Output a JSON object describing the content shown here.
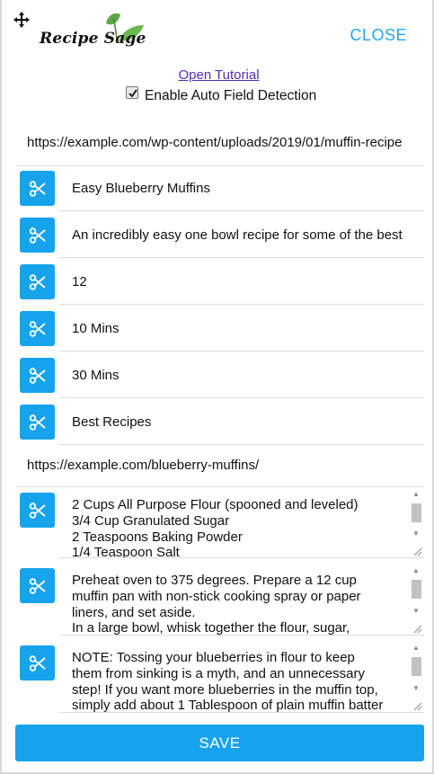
{
  "header": {
    "logo_text": "Recipe Sage",
    "close_label": "CLOSE"
  },
  "tutorial_link": "Open Tutorial",
  "auto_detect": {
    "label": "Enable Auto Field Detection",
    "checked": true
  },
  "source_url": "https://example.com/wp-content/uploads/2019/01/muffin-recipe",
  "fields": [
    {
      "value": "Easy Blueberry Muffins"
    },
    {
      "value": "An incredibly easy one bowl recipe for some of the best"
    },
    {
      "value": "12"
    },
    {
      "value": "10 Mins"
    },
    {
      "value": "30 Mins"
    },
    {
      "value": "Best Recipes"
    }
  ],
  "recipe_url": "https://example.com/blueberry-muffins/",
  "ingredients": [
    "2 Cups All Purpose Flour (spooned and leveled)",
    "3/4 Cup Granulated Sugar",
    "2 Teaspoons Baking Powder",
    "1/4 Teaspoon Salt"
  ],
  "instructions": [
    "Preheat oven to 375 degrees.  Prepare a 12 cup",
    "muffin pan with non-stick cooking spray or paper",
    "liners, and set aside.",
    "In a large bowl, whisk together the flour, sugar,"
  ],
  "notes": [
    "NOTE:  Tossing your blueberries in flour to keep",
    "them from sinking is a myth, and an unnecessary",
    "step!  If you want more blueberries in the muffin top,",
    "simply add about 1 Tablespoon of plain muffin batter"
  ],
  "save_label": "SAVE",
  "colors": {
    "accent": "#16a3ec",
    "close_text": "#22a6ee",
    "link": "#5a2bb0"
  }
}
